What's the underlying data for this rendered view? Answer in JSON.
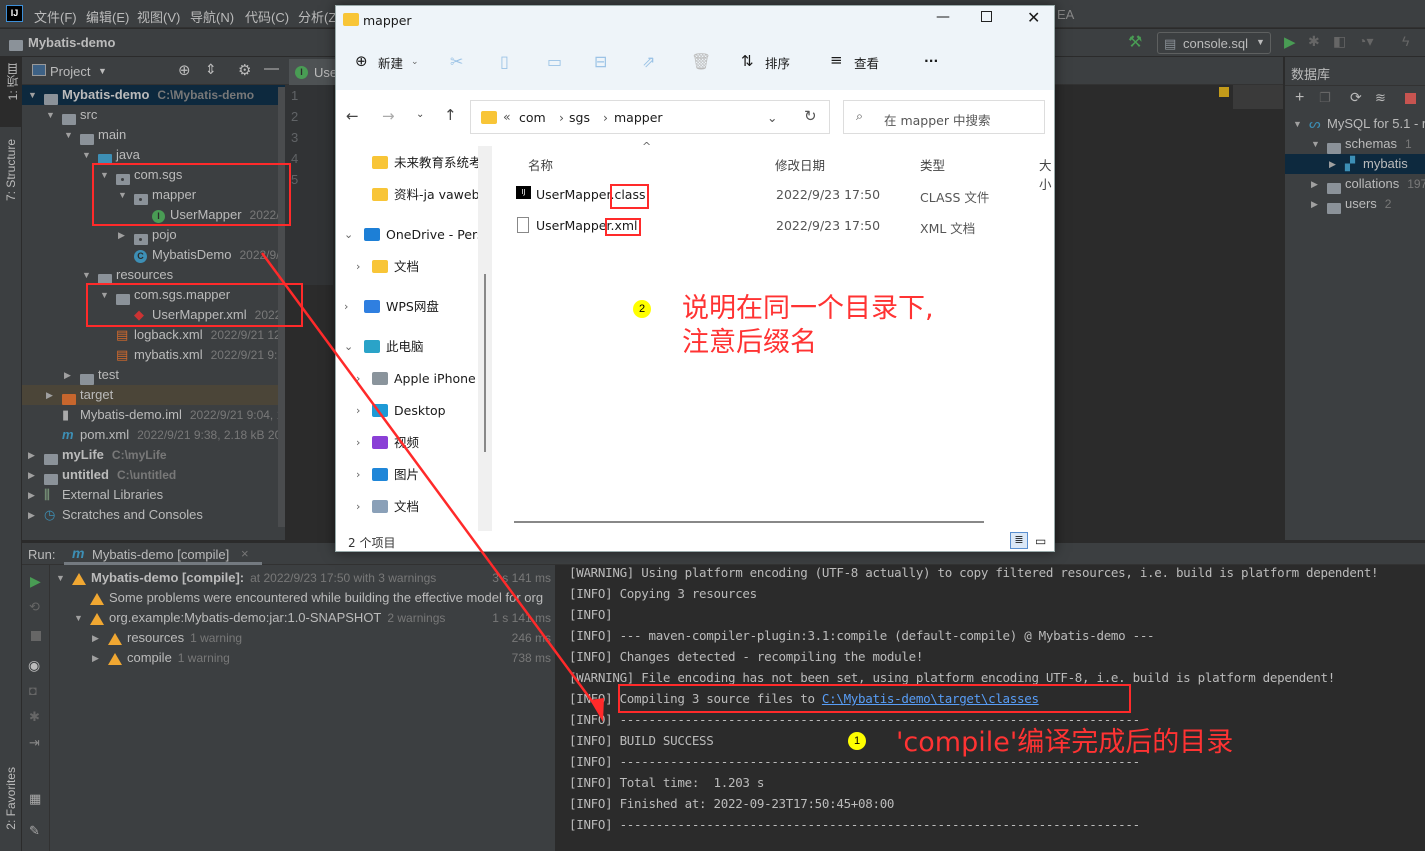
{
  "menubar": {
    "items": [
      "文件(F)",
      "编辑(E)",
      "视图(V)",
      "导航(N)",
      "代码(C)",
      "分析(Z)"
    ],
    "title_fragment": "EA"
  },
  "navbar": {
    "project": "Mybatis-demo",
    "run_config": "console.sql"
  },
  "leftstrip": {
    "project_tab": "1: 项目",
    "structure_tab": "7: Structure",
    "favorites_tab": "2: Favorites"
  },
  "project_panel": {
    "title": "Project",
    "rows": [
      {
        "label": "Mybatis-demo",
        "meta": "C:\\Mybatis-demo",
        "level": 0,
        "arrow": "down",
        "icon": "module-folder-icon",
        "bold": true,
        "state": "selected"
      },
      {
        "label": "src",
        "meta": "",
        "level": 1,
        "arrow": "down",
        "icon": "folder-icon"
      },
      {
        "label": "main",
        "meta": "",
        "level": 2,
        "arrow": "down",
        "icon": "folder-icon"
      },
      {
        "label": "java",
        "meta": "",
        "level": 3,
        "arrow": "down",
        "icon": "source-folder-icon"
      },
      {
        "label": "com.sgs",
        "meta": "",
        "level": 4,
        "arrow": "down",
        "icon": "package-icon"
      },
      {
        "label": "mapper",
        "meta": "",
        "level": 5,
        "arrow": "down",
        "icon": "package-icon"
      },
      {
        "label": "UserMapper",
        "meta": "2022/9",
        "level": 6,
        "arrow": "",
        "icon": "interface-icon"
      },
      {
        "label": "pojo",
        "meta": "",
        "level": 5,
        "arrow": "right",
        "icon": "package-icon"
      },
      {
        "label": "MybatisDemo",
        "meta": "2022/9/2",
        "level": 5,
        "arrow": "",
        "icon": "class-icon"
      },
      {
        "label": "resources",
        "meta": "",
        "level": 3,
        "arrow": "down",
        "icon": "resources-folder-icon"
      },
      {
        "label": "com.sgs.mapper",
        "meta": "",
        "level": 4,
        "arrow": "down",
        "icon": "folder-icon"
      },
      {
        "label": "UserMapper.xml",
        "meta": "2022/",
        "level": 5,
        "arrow": "",
        "icon": "mybatis-xml-icon"
      },
      {
        "label": "logback.xml",
        "meta": "2022/9/21 12:2",
        "level": 4,
        "arrow": "",
        "icon": "xml-icon"
      },
      {
        "label": "mybatis.xml",
        "meta": "2022/9/21 9:38",
        "level": 4,
        "arrow": "",
        "icon": "xml-icon"
      },
      {
        "label": "test",
        "meta": "",
        "level": 2,
        "arrow": "right",
        "icon": "folder-icon"
      },
      {
        "label": "target",
        "meta": "",
        "level": 1,
        "arrow": "right",
        "icon": "excluded-folder-icon",
        "state": "target"
      },
      {
        "label": "Mybatis-demo.iml",
        "meta": "2022/9/21 9:04, 1.7",
        "level": 1,
        "arrow": "",
        "icon": "iml-file-icon"
      },
      {
        "label": "pom.xml",
        "meta": "2022/9/21 9:38, 2.18 kB 2022/",
        "level": 1,
        "arrow": "",
        "icon": "maven-icon"
      },
      {
        "label": "myLife",
        "meta": "C:\\myLife",
        "level": 0,
        "arrow": "right",
        "icon": "module-folder-icon",
        "bold": true
      },
      {
        "label": "untitled",
        "meta": "C:\\untitled",
        "level": 0,
        "arrow": "right",
        "icon": "module-folder-icon",
        "bold": true
      },
      {
        "label": "External Libraries",
        "meta": "",
        "level": 0,
        "arrow": "right",
        "icon": "libraries-icon"
      },
      {
        "label": "Scratches and Consoles",
        "meta": "",
        "level": 0,
        "arrow": "right",
        "icon": "scratches-icon"
      }
    ]
  },
  "editor": {
    "tab": "Use",
    "line_numbers": [
      "1",
      "2",
      "3",
      "4",
      "5"
    ]
  },
  "database_panel": {
    "title": "数据库",
    "rows": [
      {
        "label": "MySQL for 5.1 - r",
        "meta": "",
        "level": 0,
        "arrow": "down",
        "icon": "mysql-icon"
      },
      {
        "label": "schemas",
        "meta": "1",
        "level": 1,
        "arrow": "down",
        "icon": "folder-icon"
      },
      {
        "label": "mybatis",
        "meta": "",
        "level": 2,
        "arrow": "right",
        "icon": "schema-icon",
        "state": "selected"
      },
      {
        "label": "collations",
        "meta": "197",
        "level": 1,
        "arrow": "right",
        "icon": "folder-icon"
      },
      {
        "label": "users",
        "meta": "2",
        "level": 1,
        "arrow": "right",
        "icon": "folder-icon"
      }
    ]
  },
  "run_panel": {
    "label": "Run:",
    "tab": "Mybatis-demo [compile]",
    "tree": [
      {
        "title": "Mybatis-demo [compile]:",
        "detail": "at 2022/9/23 17:50 with 3 warnings",
        "time": "3 s 141 ms",
        "level": 0,
        "arrow": "down",
        "bold": true
      },
      {
        "title": "Some problems were encountered while building the effective model for org",
        "detail": "",
        "time": "",
        "level": 1,
        "arrow": ""
      },
      {
        "title": "org.example:Mybatis-demo:jar:1.0-SNAPSHOT",
        "detail": "2 warnings",
        "time": "1 s 141 ms",
        "level": 1,
        "arrow": "down"
      },
      {
        "title": "resources",
        "detail": "1 warning",
        "time": "246 ms",
        "level": 2,
        "arrow": "right"
      },
      {
        "title": "compile",
        "detail": "1 warning",
        "time": "738 ms",
        "level": 2,
        "arrow": "right"
      }
    ],
    "console": [
      "[WARNING] Using platform encoding (UTF-8 actually) to copy filtered resources, i.e. build is platform dependent!",
      "[INFO] Copying 3 resources",
      "[INFO]",
      "[INFO] --- maven-compiler-plugin:3.1:compile (default-compile) @ Mybatis-demo ---",
      "[INFO] Changes detected - recompiling the module!",
      "[WARNING] File encoding has not been set, using platform encoding UTF-8, i.e. build is platform dependent!",
      "[INFO] Compiling 3 source files to ",
      "[INFO] ------------------------------------------------------------------------",
      "[INFO] BUILD SUCCESS",
      "[INFO] ------------------------------------------------------------------------",
      "[INFO] Total time:  1.203 s",
      "[INFO] Finished at: 2022-09-23T17:50:45+08:00",
      "[INFO] ------------------------------------------------------------------------"
    ],
    "console_link": "C:\\Mybatis-demo\\target\\classes"
  },
  "explorer": {
    "title": "mapper",
    "new": "新建",
    "sort": "排序",
    "view": "查看",
    "more": "···",
    "breadcrumb": [
      "com",
      "sgs",
      "mapper"
    ],
    "search_placeholder": "在 mapper 中搜索",
    "columns": [
      "名称",
      "修改日期",
      "类型",
      "大小"
    ],
    "files": [
      {
        "name": "UserMapper.class",
        "date": "2022/9/23 17:50",
        "type": "CLASS 文件",
        "icon": "intellij-file-icon"
      },
      {
        "name": "UserMapper.xml",
        "date": "2022/9/23 17:50",
        "type": "XML 文档",
        "icon": "document-icon"
      }
    ],
    "nav": [
      {
        "label": "未来教育系统考",
        "level": 1,
        "chev": "",
        "icon": "folder-icon",
        "color": "#f8c537"
      },
      {
        "label": "资料-ja vaweb/",
        "level": 1,
        "chev": "",
        "icon": "folder-icon",
        "color": "#f8c537"
      },
      {
        "label": "OneDrive - Pers",
        "level": 0,
        "chev": "down",
        "icon": "cloud-icon",
        "color": "#1d7fd6"
      },
      {
        "label": "文档",
        "level": 1,
        "chev": "right",
        "icon": "folder-icon",
        "color": "#f8c537"
      },
      {
        "label": "WPS网盘",
        "level": 0,
        "chev": "right",
        "icon": "cloud-icon",
        "color": "#2f7fe0"
      },
      {
        "label": "此电脑",
        "level": 0,
        "chev": "down",
        "icon": "computer-icon",
        "color": "#2aa3c8"
      },
      {
        "label": "Apple iPhone",
        "level": 1,
        "chev": "right",
        "icon": "phone-icon",
        "color": "#8a949c"
      },
      {
        "label": "Desktop",
        "level": 1,
        "chev": "right",
        "icon": "desktop-icon",
        "color": "#1e9ad6"
      },
      {
        "label": "视频",
        "level": 1,
        "chev": "right",
        "icon": "video-icon",
        "color": "#8a3fd6"
      },
      {
        "label": "图片",
        "level": 1,
        "chev": "right",
        "icon": "pictures-icon",
        "color": "#1f86d8"
      },
      {
        "label": "文档",
        "level": 1,
        "chev": "right",
        "icon": "documents-icon",
        "color": "#8aa0b8"
      }
    ],
    "status": "2 个项目"
  },
  "annotations": {
    "note2_num": "2",
    "note2_line1": "说明在同一个目录下,",
    "note2_line2": "注意后缀名",
    "note1_num": "1",
    "note1": "'compile'编译完成后的目录",
    "color": "#ff3333"
  }
}
